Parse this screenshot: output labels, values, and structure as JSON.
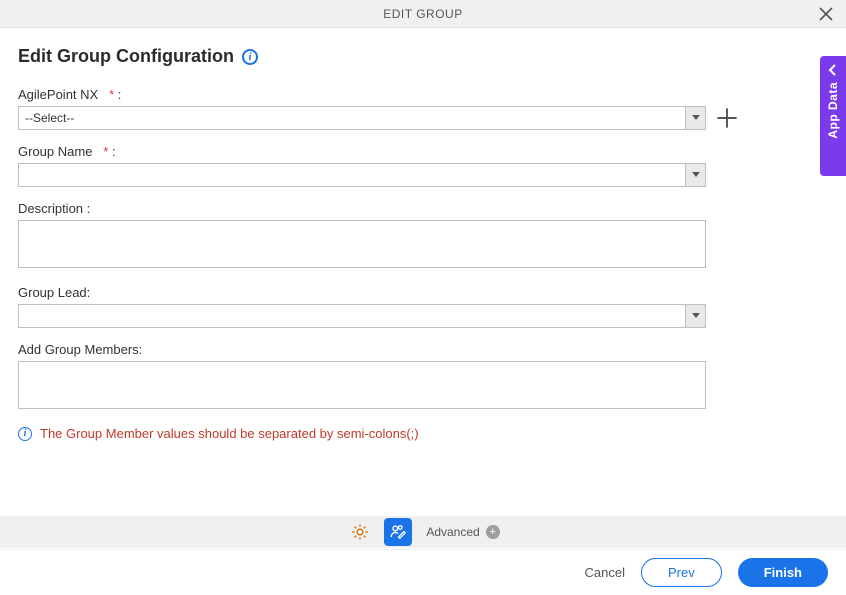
{
  "header": {
    "title": "EDIT GROUP"
  },
  "side_tab": {
    "label": "App Data"
  },
  "page": {
    "title": "Edit Group Configuration"
  },
  "fields": {
    "agilepoint": {
      "label": "AgilePoint NX",
      "required_marker": "*",
      "colon": ":",
      "value": "--Select--"
    },
    "group_name": {
      "label": "Group Name",
      "required_marker": "*",
      "colon": ":",
      "value": ""
    },
    "description": {
      "label": "Description :",
      "value": ""
    },
    "group_lead": {
      "label": "Group Lead:",
      "value": ""
    },
    "add_members": {
      "label": "Add Group Members:",
      "value": ""
    }
  },
  "hint": {
    "text": "The Group Member values should be separated by semi-colons(;)"
  },
  "toolbar": {
    "advanced_label": "Advanced"
  },
  "footer": {
    "cancel": "Cancel",
    "prev": "Prev",
    "finish": "Finish"
  }
}
